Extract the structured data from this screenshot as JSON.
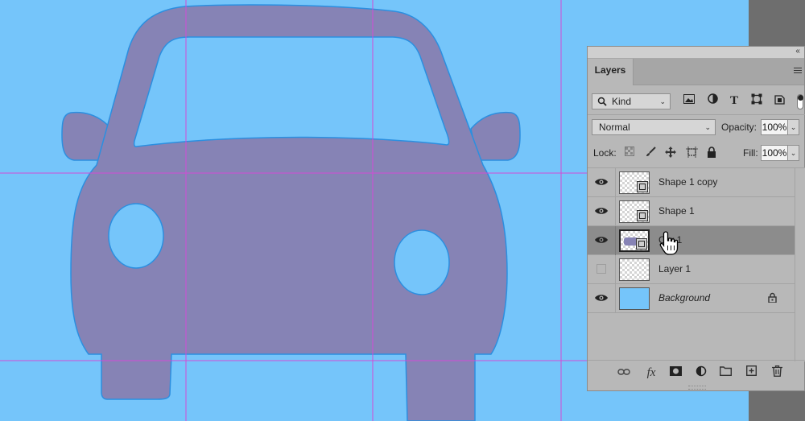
{
  "colors": {
    "canvas_bg": "#75c5fa",
    "car_fill": "#8683b5",
    "car_stroke": "#2b8fe0",
    "guide": "#d24bd6",
    "panel_bg": "#b8b8b8",
    "selected_row": "#8c8c8c"
  },
  "panel": {
    "collapse_icon": "double-chevron-left-icon",
    "tab_label": "Layers",
    "menu_icon": "panel-menu-icon"
  },
  "filter": {
    "kind_label": "Kind",
    "icons": [
      "image-filter-icon",
      "adjustment-filter-icon",
      "type-filter-icon",
      "shape-filter-icon",
      "smart-object-filter-icon"
    ]
  },
  "blend": {
    "mode": "Normal",
    "opacity_label": "Opacity:",
    "opacity_value": "100%"
  },
  "lock": {
    "label": "Lock:",
    "icons": [
      "lock-transparent-icon",
      "lock-paint-icon",
      "lock-position-icon",
      "lock-artboard-icon",
      "lock-all-icon"
    ],
    "fill_label": "Fill:",
    "fill_value": "100%"
  },
  "layers": [
    {
      "name": "Shape 1 copy",
      "visible": true,
      "type": "shape",
      "selected": false
    },
    {
      "name": "Shape 1",
      "visible": true,
      "type": "shape",
      "selected": false
    },
    {
      "name": "Car 1",
      "visible": true,
      "type": "shape",
      "selected": true
    },
    {
      "name": "Layer 1",
      "visible": false,
      "type": "pixel",
      "selected": false
    },
    {
      "name": "Background",
      "visible": true,
      "type": "background",
      "selected": false,
      "locked": true
    }
  ],
  "bottom_icons": [
    "link-layers-icon",
    "fx-icon",
    "add-mask-icon",
    "adjustment-layer-icon",
    "new-group-icon",
    "new-layer-icon",
    "delete-layer-icon"
  ]
}
